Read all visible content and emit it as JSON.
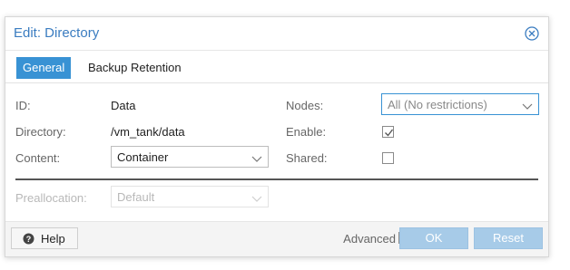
{
  "dialog": {
    "title": "Edit: Directory",
    "close_icon": "close-circle-icon"
  },
  "tabs": [
    {
      "label": "General",
      "active": true
    },
    {
      "label": "Backup Retention",
      "active": false
    }
  ],
  "fields": {
    "id_label": "ID:",
    "id_value": "Data",
    "directory_label": "Directory:",
    "directory_value": "/vm_tank/data",
    "content_label": "Content:",
    "content_value": "Container",
    "nodes_label": "Nodes:",
    "nodes_value": "All (No restrictions)",
    "enable_label": "Enable:",
    "enable_checked": true,
    "shared_label": "Shared:",
    "shared_checked": false,
    "preallocation_label": "Preallocation:",
    "preallocation_value": "Default"
  },
  "footer": {
    "help_label": "Help",
    "advanced_label": "Advanced",
    "advanced_checked": true,
    "ok_label": "OK",
    "reset_label": "Reset"
  },
  "colors": {
    "accent": "#3892d4",
    "title": "#3a7cc0",
    "disabled_button": "#a7cbe8"
  }
}
